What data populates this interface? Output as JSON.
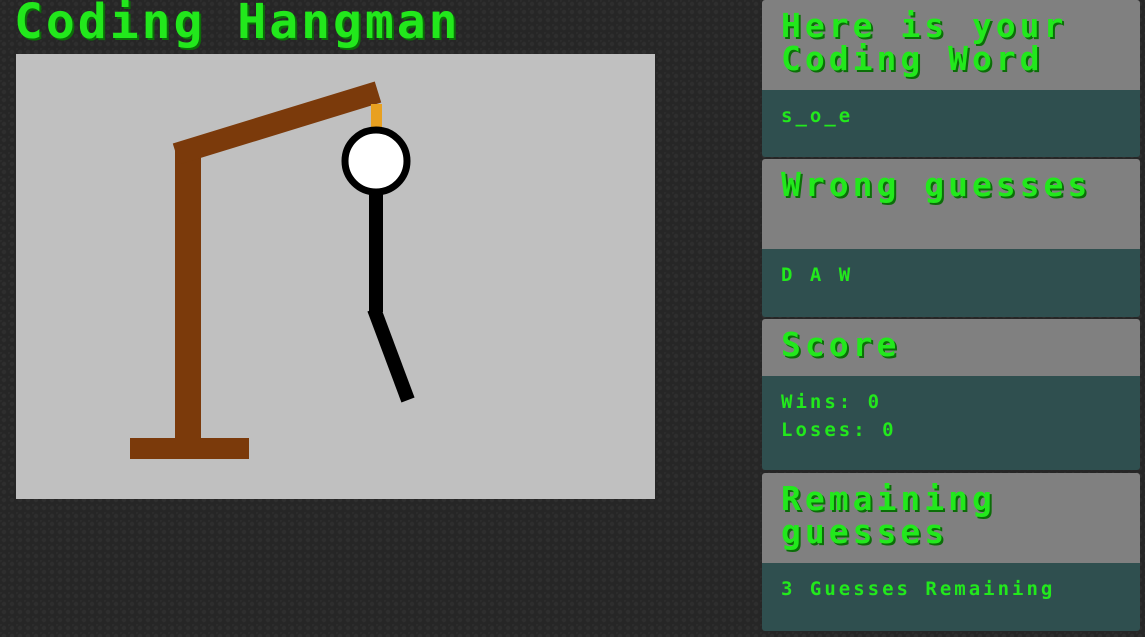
{
  "page": {
    "title": "Coding Hangman"
  },
  "panels": {
    "word": {
      "heading": "Here is your Coding Word",
      "value": "s_o_e"
    },
    "wrong": {
      "heading": "Wrong guesses",
      "value": "D A W"
    },
    "score": {
      "heading": "Score",
      "wins": "Wins: 0",
      "loses": "Loses: 0"
    },
    "remaining": {
      "heading": "Remaining guesses",
      "value": "3 Guesses Remaining"
    }
  },
  "colors": {
    "accent": "#22e81c",
    "gallows": "#7b3a0b",
    "rope": "#e8a020",
    "figure": "#000000",
    "canvas": "#c0c0c0",
    "panel_header": "#808080",
    "panel_body": "#2f4f4f"
  }
}
